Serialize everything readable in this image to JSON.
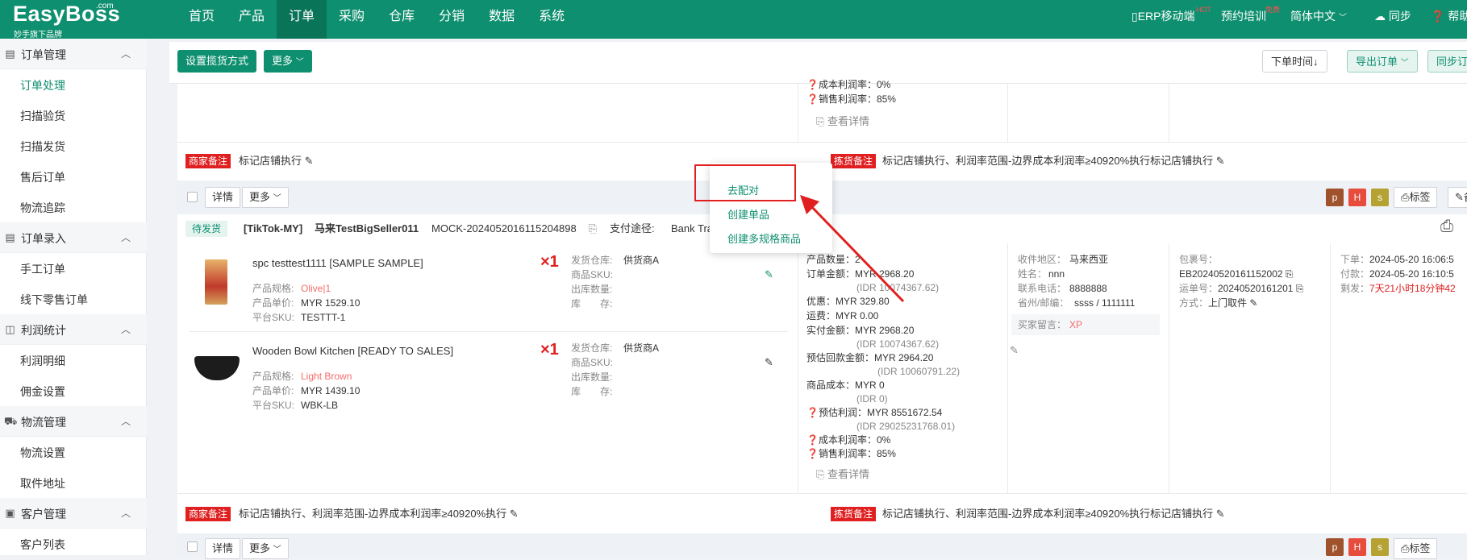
{
  "app": {
    "brand": "EasyBoss",
    "brand_com": ".com",
    "brand_sub": "妙手旗下品牌"
  },
  "nav": [
    "首页",
    "产品",
    "订单",
    "采购",
    "仓库",
    "分销",
    "数据",
    "系统"
  ],
  "nav_active": "订单",
  "right_nav": {
    "mobile": "ERP移动端",
    "mobile_badge": "HOT",
    "training": "预约培训",
    "training_badge": "免费",
    "language": "简体中文",
    "sync": "同步",
    "help": "帮助"
  },
  "sidebar": {
    "g1": {
      "label": "订单管理",
      "items": [
        "订单处理",
        "扫描验货",
        "扫描发货",
        "售后订单",
        "物流追踪"
      ]
    },
    "g2": {
      "label": "订单录入",
      "items": [
        "手工订单",
        "线下零售订单"
      ]
    },
    "g3": {
      "label": "利润统计",
      "items": [
        "利润明细",
        "佣金设置"
      ]
    },
    "g4": {
      "label": "物流管理",
      "items": [
        "物流设置",
        "取件地址"
      ]
    },
    "g5": {
      "label": "客户管理",
      "items": [
        "客户列表"
      ]
    }
  },
  "toolbar": {
    "set_packing": "设置揽货方式",
    "more": "更多",
    "order_time": "下单时间↓",
    "export": "导出订单",
    "sync_orders": "同步订"
  },
  "top_partial": {
    "cost_margin": "❓成本利润率：0%",
    "sales_margin": "❓销售利润率：85%",
    "view_detail": "查看详情"
  },
  "notes1": {
    "merchant_tag": "商家备注",
    "merchant_text": "标记店铺执行",
    "picking_tag": "拣货备注",
    "picking_text": "标记店铺执行、利润率范围-边界成本利润率≥40920%执行标记店铺执行"
  },
  "order_bar": {
    "detail": "详情",
    "more": "更多",
    "badges": [
      "p",
      "H",
      "s"
    ],
    "label_btn": "标签",
    "remark_btn": "备"
  },
  "order": {
    "status": "待发货",
    "shop": "[TikTok-MY]",
    "seller": "马来TestBigSeller011",
    "order_no": "MOCK-2024052016115204898",
    "pay_label": "支付途径:",
    "pay_value": "Bank Tra",
    "items": [
      {
        "name": "spc testtest1111 [SAMPLE SAMPLE]",
        "spec_label": "产品规格:",
        "spec": "Olive|1",
        "price_label": "产品单价:",
        "price": "MYR 1529.10",
        "sku_label": "平台SKU:",
        "sku": "TESTTT-1",
        "qty": "×1",
        "wh_label": "发货仓库:",
        "wh": "供货商A",
        "psku_label": "商品SKU:",
        "out_label": "出库数量:",
        "stock_label": "库　　存:"
      },
      {
        "name": "Wooden Bowl Kitchen [READY TO SALES]",
        "spec_label": "产品规格:",
        "spec": "Light Brown",
        "price_label": "产品单价:",
        "price": "MYR 1439.10",
        "sku_label": "平台SKU:",
        "sku": "WBK-LB",
        "qty": "×1",
        "wh_label": "发货仓库:",
        "wh": "供货商A",
        "psku_label": "商品SKU:",
        "out_label": "出库数量:",
        "stock_label": "库　　存:"
      }
    ],
    "money": [
      "产品数量：2",
      "订单金额：MYR 2968.20",
      "(IDR 10074367.62)",
      "优惠：MYR 329.80",
      "运费：MYR 0.00",
      "实付金额：MYR 2968.20",
      "(IDR 10074367.62)",
      "预估回款金额：MYR 2964.20",
      "(IDR 10060791.22)",
      "商品成本：MYR 0",
      "(IDR 0)",
      "❓预估利润：MYR 8551672.54",
      "(IDR 29025231768.01)",
      "❓成本利润率：0%",
      "❓销售利润率：85%"
    ],
    "view_detail": "查看详情",
    "buyer": {
      "region_label": "收件地区：",
      "region": "马来西亚",
      "name_label": "姓名：",
      "name": "nnn",
      "phone_label": "联系电话：",
      "phone": "8888888",
      "postal_label": "省州/邮编：",
      "postal": "ssss / 1111111",
      "msg_label": "买家留言：",
      "msg": "XP"
    },
    "package": {
      "pkg_label": "包裹号：",
      "pkg": "EB20240520161152002",
      "tracking_label": "运单号：",
      "tracking": "20240520161201",
      "method_label": "方式：",
      "method": "上门取件"
    },
    "times": {
      "order_label": "下单：",
      "order": "2024-05-20 16:06:5",
      "pay_label": "付款：",
      "pay": "2024-05-20 16:10:5",
      "left_label": "剩发：",
      "left": "7天21小时18分钟42"
    }
  },
  "popup": {
    "items": [
      "去配对",
      "创建单品",
      "创建多规格商品"
    ]
  },
  "notes2": {
    "merchant_tag": "商家备注",
    "merchant_text": "标记店铺执行、利润率范围-边界成本利润率≥40920%执行",
    "picking_tag": "拣货备注",
    "picking_text": "标记店铺执行、利润率范围-边界成本利润率≥40920%执行标记店铺执行"
  },
  "order_bar2": {
    "detail": "详情",
    "more": "更多",
    "badges": [
      "p",
      "H",
      "s"
    ],
    "label_btn": "标签"
  },
  "colors": {
    "primary": "#0e8f6f",
    "red": "#e02020",
    "badge_p": "#a0522d",
    "badge_h": "#e74c3c",
    "badge_s": "#b5a233"
  }
}
